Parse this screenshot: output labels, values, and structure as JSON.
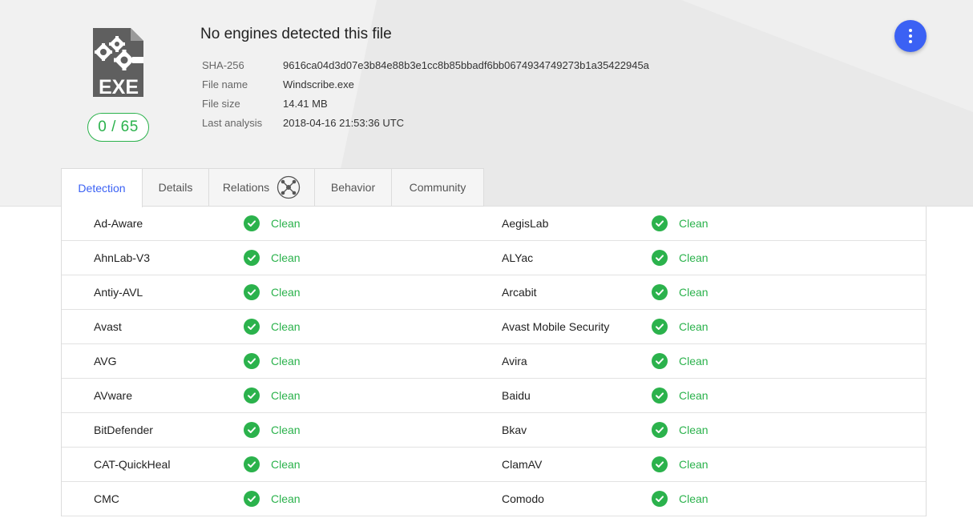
{
  "summary": {
    "title": "No engines detected this file",
    "score": "0 / 65",
    "file_type_label": "EXE"
  },
  "meta": [
    {
      "key": "SHA-256",
      "value": "9616ca04d3d07e3b84e88b3e1cc8b85bbadf6bb0674934749273b1a35422945a"
    },
    {
      "key": "File name",
      "value": "Windscribe.exe"
    },
    {
      "key": "File size",
      "value": "14.41 MB"
    },
    {
      "key": "Last analysis",
      "value": "2018-04-16 21:53:36 UTC"
    }
  ],
  "tabs": [
    {
      "label": "Detection",
      "active": true
    },
    {
      "label": "Details",
      "active": false
    },
    {
      "label": "Relations",
      "active": false,
      "icon": "relations-graph-icon"
    },
    {
      "label": "Behavior",
      "active": false
    },
    {
      "label": "Community",
      "active": false
    }
  ],
  "detections": [
    {
      "left": {
        "engine": "Ad-Aware",
        "result": "Clean"
      },
      "right": {
        "engine": "AegisLab",
        "result": "Clean"
      }
    },
    {
      "left": {
        "engine": "AhnLab-V3",
        "result": "Clean"
      },
      "right": {
        "engine": "ALYac",
        "result": "Clean"
      }
    },
    {
      "left": {
        "engine": "Antiy-AVL",
        "result": "Clean"
      },
      "right": {
        "engine": "Arcabit",
        "result": "Clean"
      }
    },
    {
      "left": {
        "engine": "Avast",
        "result": "Clean"
      },
      "right": {
        "engine": "Avast Mobile Security",
        "result": "Clean"
      }
    },
    {
      "left": {
        "engine": "AVG",
        "result": "Clean"
      },
      "right": {
        "engine": "Avira",
        "result": "Clean"
      }
    },
    {
      "left": {
        "engine": "AVware",
        "result": "Clean"
      },
      "right": {
        "engine": "Baidu",
        "result": "Clean"
      }
    },
    {
      "left": {
        "engine": "BitDefender",
        "result": "Clean"
      },
      "right": {
        "engine": "Bkav",
        "result": "Clean"
      }
    },
    {
      "left": {
        "engine": "CAT-QuickHeal",
        "result": "Clean"
      },
      "right": {
        "engine": "ClamAV",
        "result": "Clean"
      }
    },
    {
      "left": {
        "engine": "CMC",
        "result": "Clean"
      },
      "right": {
        "engine": "Comodo",
        "result": "Clean"
      }
    }
  ],
  "colors": {
    "accent": "#3b61f4",
    "clean": "#2bb24c",
    "icon_gray": "#5f5f5f"
  }
}
